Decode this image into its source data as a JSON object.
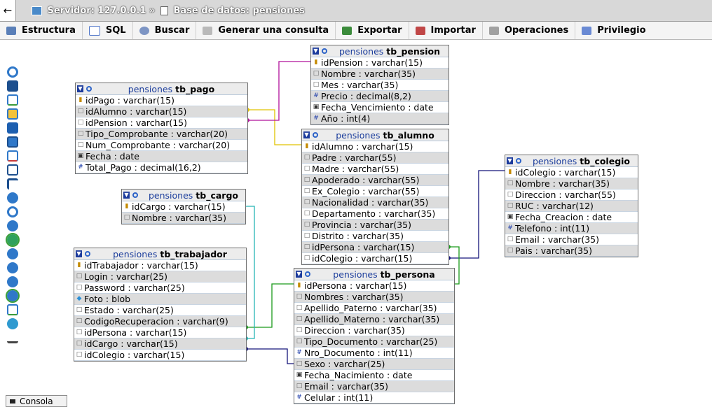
{
  "breadcrumb": {
    "server": "Servidor: 127.0.0.1",
    "sep": "»",
    "database": "Base de datos: pensiones"
  },
  "tabs": [
    {
      "label": "Estructura",
      "icon": "structure-icon",
      "color": "#5a7fb8"
    },
    {
      "label": "SQL",
      "icon": "sql-icon",
      "color": "#4d74c8"
    },
    {
      "label": "Buscar",
      "icon": "search-icon",
      "color": "#7d95c4"
    },
    {
      "label": "Generar una consulta",
      "icon": "query-icon",
      "color": "#b9b9b9"
    },
    {
      "label": "Exportar",
      "icon": "export-icon",
      "color": "#3b8b3b"
    },
    {
      "label": "Importar",
      "icon": "import-icon",
      "color": "#c04646"
    },
    {
      "label": "Operaciones",
      "icon": "wrench-icon",
      "color": "#a1a1a1"
    },
    {
      "label": "Privilegio",
      "icon": "privileges-icon",
      "color": "#6a8ad4"
    }
  ],
  "console": {
    "label": "Consola"
  },
  "tables": {
    "tb_pension": {
      "db": "pensiones",
      "name": "tb_pension",
      "columns": [
        {
          "icon": "k",
          "text": "idPension : varchar(15)"
        },
        {
          "icon": "v",
          "text": "Nombre : varchar(35)"
        },
        {
          "icon": "v",
          "text": "Mes : varchar(35)"
        },
        {
          "icon": "n",
          "text": "Precio : decimal(8,2)"
        },
        {
          "icon": "d",
          "text": "Fecha_Vencimiento : date"
        },
        {
          "icon": "n",
          "text": "Año : int(4)"
        }
      ]
    },
    "tb_pago": {
      "db": "pensiones",
      "name": "tb_pago",
      "columns": [
        {
          "icon": "k",
          "text": "idPago : varchar(15)"
        },
        {
          "icon": "v",
          "text": "idAlumno : varchar(15)"
        },
        {
          "icon": "v",
          "text": "idPension : varchar(15)"
        },
        {
          "icon": "v",
          "text": "Tipo_Comprobante : varchar(20)"
        },
        {
          "icon": "v",
          "text": "Num_Comprobante : varchar(20)"
        },
        {
          "icon": "d",
          "text": "Fecha : date"
        },
        {
          "icon": "n",
          "text": "Total_Pago : decimal(16,2)"
        }
      ]
    },
    "tb_alumno": {
      "db": "pensiones",
      "name": "tb_alumno",
      "columns": [
        {
          "icon": "k",
          "text": "idAlumno : varchar(15)"
        },
        {
          "icon": "v",
          "text": "Padre : varchar(55)"
        },
        {
          "icon": "v",
          "text": "Madre : varchar(55)"
        },
        {
          "icon": "v",
          "text": "Apoderado : varchar(55)"
        },
        {
          "icon": "v",
          "text": "Ex_Colegio : varchar(55)"
        },
        {
          "icon": "v",
          "text": "Nacionalidad : varchar(35)"
        },
        {
          "icon": "v",
          "text": "Departamento : varchar(35)"
        },
        {
          "icon": "v",
          "text": "Provincia : varchar(35)"
        },
        {
          "icon": "v",
          "text": "Distrito : varchar(35)"
        },
        {
          "icon": "v",
          "text": "idPersona : varchar(15)"
        },
        {
          "icon": "v",
          "text": "idColegio : varchar(15)"
        }
      ]
    },
    "tb_colegio": {
      "db": "pensiones",
      "name": "tb_colegio",
      "columns": [
        {
          "icon": "k",
          "text": "idColegio : varchar(15)"
        },
        {
          "icon": "v",
          "text": "Nombre : varchar(35)"
        },
        {
          "icon": "v",
          "text": "Direccion : varchar(55)"
        },
        {
          "icon": "v",
          "text": "RUC : varchar(12)"
        },
        {
          "icon": "d",
          "text": "Fecha_Creacion : date"
        },
        {
          "icon": "n",
          "text": "Telefono : int(11)"
        },
        {
          "icon": "v",
          "text": "Email : varchar(35)"
        },
        {
          "icon": "v",
          "text": "Pais : varchar(35)"
        }
      ]
    },
    "tb_cargo": {
      "db": "pensiones",
      "name": "tb_cargo",
      "columns": [
        {
          "icon": "k",
          "text": "idCargo : varchar(15)"
        },
        {
          "icon": "v",
          "text": "Nombre : varchar(35)"
        }
      ]
    },
    "tb_trabajador": {
      "db": "pensiones",
      "name": "tb_trabajador",
      "columns": [
        {
          "icon": "k",
          "text": "idTrabajador : varchar(15)"
        },
        {
          "icon": "v",
          "text": "Login : varchar(25)"
        },
        {
          "icon": "v",
          "text": "Password : varchar(25)"
        },
        {
          "icon": "b",
          "text": "Foto : blob"
        },
        {
          "icon": "v",
          "text": "Estado : varchar(25)"
        },
        {
          "icon": "v",
          "text": "CodigoRecuperacion : varchar(9)"
        },
        {
          "icon": "v",
          "text": "idPersona : varchar(15)"
        },
        {
          "icon": "v",
          "text": "idCargo : varchar(15)"
        },
        {
          "icon": "v",
          "text": "idColegio : varchar(15)"
        }
      ]
    },
    "tb_persona": {
      "db": "pensiones",
      "name": "tb_persona",
      "columns": [
        {
          "icon": "k",
          "text": "idPersona : varchar(15)"
        },
        {
          "icon": "v",
          "text": "Nombres : varchar(35)"
        },
        {
          "icon": "v",
          "text": "Apellido_Paterno : varchar(35)"
        },
        {
          "icon": "v",
          "text": "Apellido_Materno : varchar(35)"
        },
        {
          "icon": "v",
          "text": "Direccion : varchar(35)"
        },
        {
          "icon": "v",
          "text": "Tipo_Documento : varchar(25)"
        },
        {
          "icon": "n",
          "text": "Nro_Documento : int(11)"
        },
        {
          "icon": "v",
          "text": "Sexo : varchar(25)"
        },
        {
          "icon": "d",
          "text": "Fecha_Nacimiento : date"
        },
        {
          "icon": "v",
          "text": "Email : varchar(35)"
        },
        {
          "icon": "n",
          "text": "Celular : int(11)"
        }
      ]
    }
  },
  "relation_colors": {
    "pago_alumno": "#e0c200",
    "pago_pension": "#b0109a",
    "alumno_colegio": "#14147a",
    "alumno_persona": "#1a9a1a",
    "trabajador_persona": "#1a9a1a",
    "trabajador_cargo": "#25b5b5",
    "trabajador_colegio": "#14147a"
  }
}
